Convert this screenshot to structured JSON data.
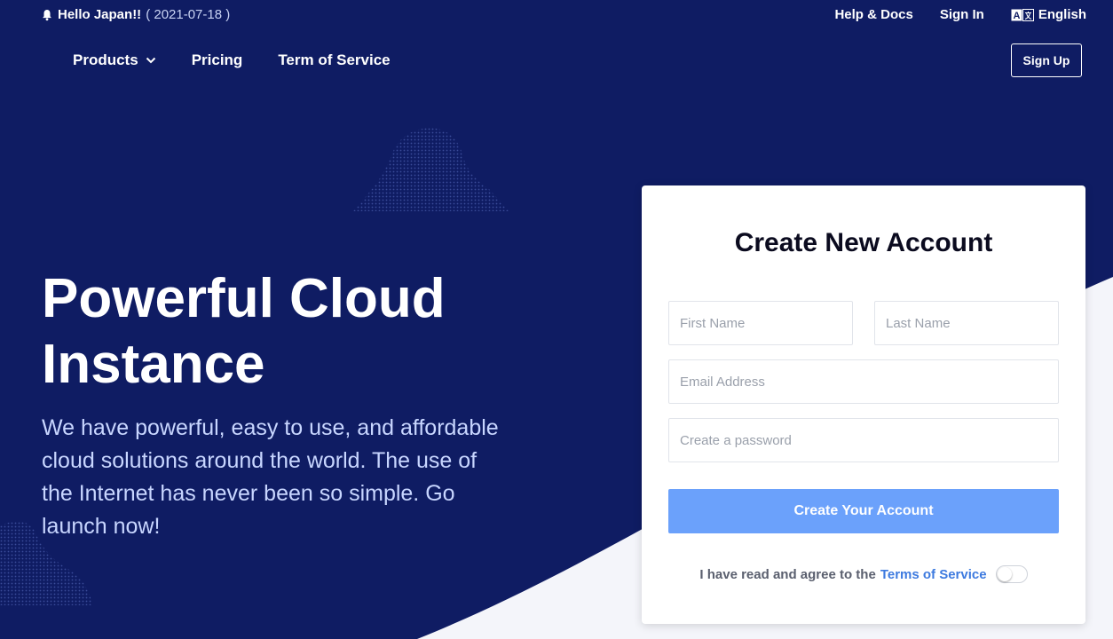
{
  "colors": {
    "background": "#0f1c63",
    "accent_curve": "#f4f5fa",
    "primary_button": "#6ba1fb",
    "link": "#3d7adf",
    "subtitle": "#c8d6ff"
  },
  "topbar": {
    "announcement_icon": "bell-icon",
    "announcement": "Hello Japan!!",
    "announcement_date": "( 2021-07-18 )",
    "help_label": "Help & Docs",
    "signin_label": "Sign In",
    "language_icon": "translate-icon",
    "language_label": "English"
  },
  "nav": {
    "products_label": "Products",
    "products_icon": "chevron-down-icon",
    "pricing_label": "Pricing",
    "terms_label": "Term of Service",
    "signup_label": "Sign Up"
  },
  "hero": {
    "title": "Powerful Cloud Instance",
    "subtitle": "We have powerful, easy to use, and affordable cloud solutions around the world. The use of the Internet has never been so simple. Go launch now!"
  },
  "signup_form": {
    "title": "Create New Account",
    "first_name_placeholder": "First Name",
    "last_name_placeholder": "Last Name",
    "email_placeholder": "Email Address",
    "password_placeholder": "Create a password",
    "submit_label": "Create Your Account",
    "agree_text": "I have read and agree to the",
    "terms_link": "Terms of Service",
    "agree_toggle_on": false
  }
}
